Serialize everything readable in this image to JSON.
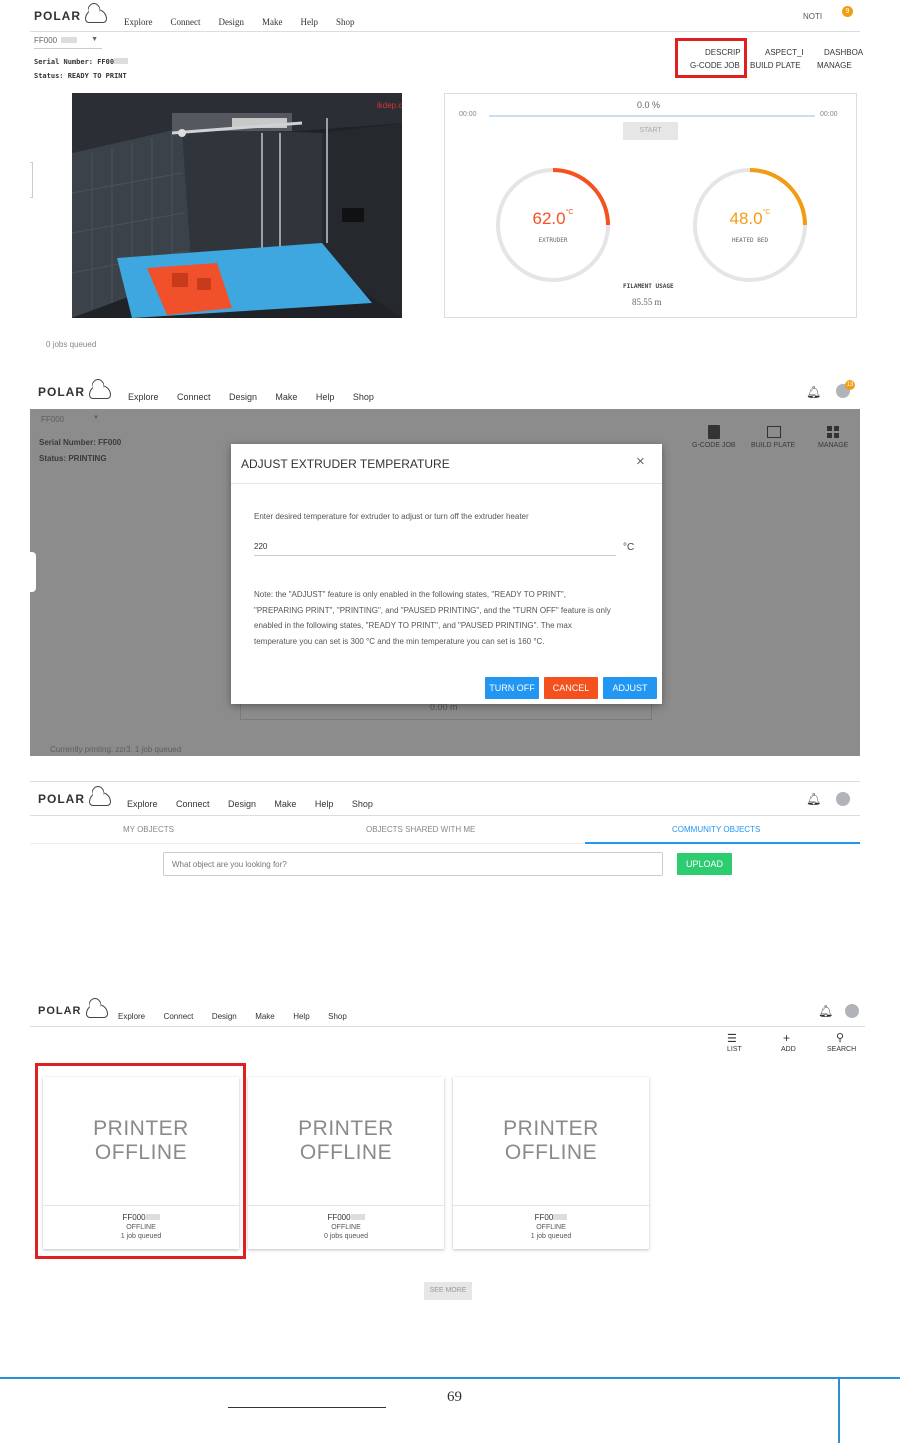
{
  "brand": "POLAR",
  "nav": [
    "Explore",
    "Connect",
    "Design",
    "Make",
    "Help",
    "Shop"
  ],
  "panel1": {
    "printer_select": "FF000",
    "serial": "Serial Number: FF00",
    "status": "Status: READY TO PRINT",
    "notif_label": "NOTI",
    "notif_badge": "9",
    "tabs_top": [
      "DESCRIP",
      "ASPECT_I",
      "DASHBOA"
    ],
    "tabs_bottom": [
      "G-CODE JOB",
      "BUILD PLATE",
      "MANAGE"
    ],
    "video_watermark": "ikdep.com",
    "time_start": "00:00",
    "time_end": "00:00",
    "progress_percent": "0.0 %",
    "progress_value": 0,
    "start_label": "START",
    "extruder_temp": "62.0",
    "extruder_label": "EXTRUDER",
    "bed_temp": "48.0",
    "bed_label": "HEATED BED",
    "temp_unit": "°C",
    "filament_label": "FILAMENT USAGE",
    "filament_value": "85.55 m",
    "queue": "0 jobs queued"
  },
  "panel2": {
    "printer_select": "FF000",
    "serial": "Serial Number: FF000",
    "status": "Status: PRINTING",
    "notif_badge": "13",
    "tabs": [
      "G-CODE JOB",
      "BUILD PLATE",
      "MANAGE"
    ],
    "dialog_title": "ADJUST EXTRUDER TEMPERATURE",
    "dialog_instruction": "Enter desired temperature for extruder to adjust or turn off the extruder heater",
    "temp_value": "220",
    "temp_unit": "°C",
    "note_line1": "Note: the \"ADJUST\" feature is only enabled in the following states, \"READY TO PRINT\",",
    "note_line2": "\"PREPARING PRINT\", \"PRINTING\", and \"PAUSED PRINTING\", and the \"TURN OFF\" feature is only",
    "note_line3": "enabled in the following states, \"READY TO PRINT\", and \"PAUSED PRINTING\". The max",
    "note_line4": "temperature you can set is 300 °C and the min temperature you can set is 160 °C.",
    "btn_turn_off": "TURN OFF",
    "btn_cancel": "CANCEL",
    "btn_adjust": "ADJUST",
    "bg_filament": "0.00 m",
    "footer": "Currently printing: zzr3. 1 job queued"
  },
  "panel3": {
    "tabs": [
      "MY OBJECTS",
      "OBJECTS SHARED WITH ME",
      "COMMUNITY OBJECTS"
    ],
    "search_placeholder": "What object are you looking for?",
    "upload": "UPLOAD"
  },
  "panel4": {
    "toolbar": [
      "LIST",
      "ADD",
      "SEARCH"
    ],
    "cards": [
      {
        "state_line1": "PRINTER",
        "state_line2": "OFFLINE",
        "id": "FF000",
        "status": "OFFLINE",
        "queue": "1 job queued"
      },
      {
        "state_line1": "PRINTER",
        "state_line2": "OFFLINE",
        "id": "FF000",
        "status": "OFFLINE",
        "queue": "0 jobs queued"
      },
      {
        "state_line1": "PRINTER",
        "state_line2": "OFFLINE",
        "id": "FF00",
        "status": "OFFLINE",
        "queue": "1 job queued"
      }
    ],
    "see_more": "SEE MORE"
  },
  "page_number": "69",
  "colors": {
    "accent_red": "#e02020",
    "blue": "#2196f3",
    "orange_red": "#f4511e",
    "orange": "#f39c12",
    "green": "#2ecc71"
  }
}
